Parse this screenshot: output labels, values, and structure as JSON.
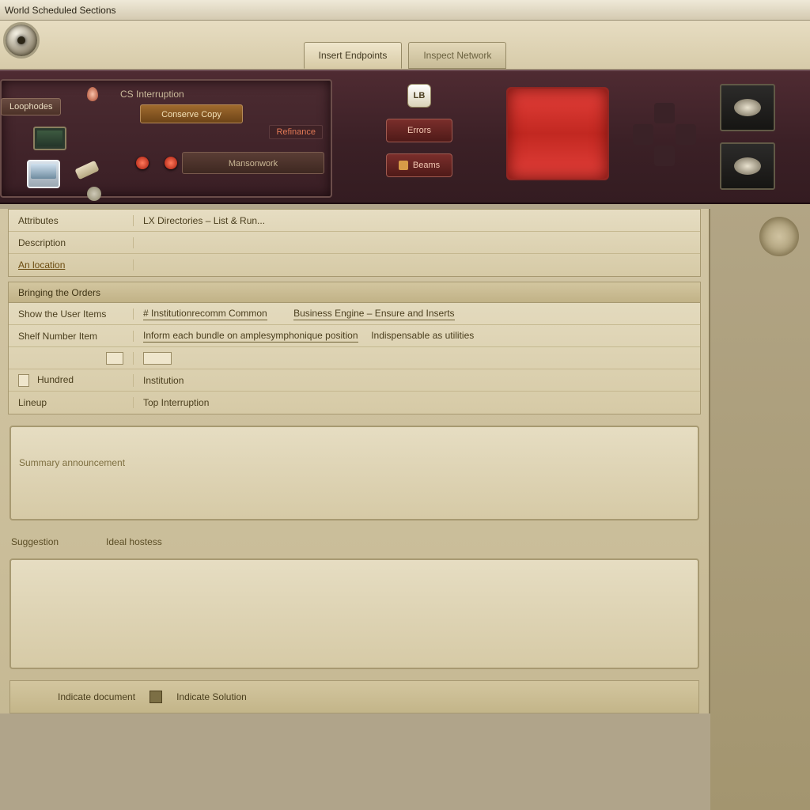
{
  "window": {
    "title": "World Scheduled Sections"
  },
  "tabs": {
    "a": "Insert Endpoints",
    "b": "Inspect Network"
  },
  "ribbon": {
    "left": {
      "chip": "Loophodes",
      "cs_label": "CS Interruption",
      "orange_btn": "Conserve Copy",
      "red_tag": "Refinance",
      "slot": "Mansonwork"
    },
    "lb": "LB",
    "btn1": "Errors",
    "btn2": "Beams"
  },
  "panel1": {
    "r0l": "Attributes",
    "r0r": "LX Directories – List & Run...",
    "r1l": "Description",
    "r2l": "An location"
  },
  "panel2": {
    "hdr": "Bringing the Orders",
    "r0l": "Show the User Items",
    "r0m": "# Institutionrecomm Common",
    "r0m2": "Business Engine – Ensure and Inserts",
    "r1l": "Shelf Number  Item",
    "r1m": "Inform each bundle on amplesymphonique position",
    "r1m2": "Indispensable as utilities",
    "r2l": "",
    "r3l": "Hundred",
    "r3m": "Institution",
    "r4l": "Lineup",
    "r4m": "Top Interruption"
  },
  "panel3": {
    "faded": "Summary announcement"
  },
  "slim": {
    "a": "Suggestion",
    "b": "Ideal hostess"
  },
  "footer": {
    "a": "Indicate document",
    "b": "Indicate Solution"
  }
}
